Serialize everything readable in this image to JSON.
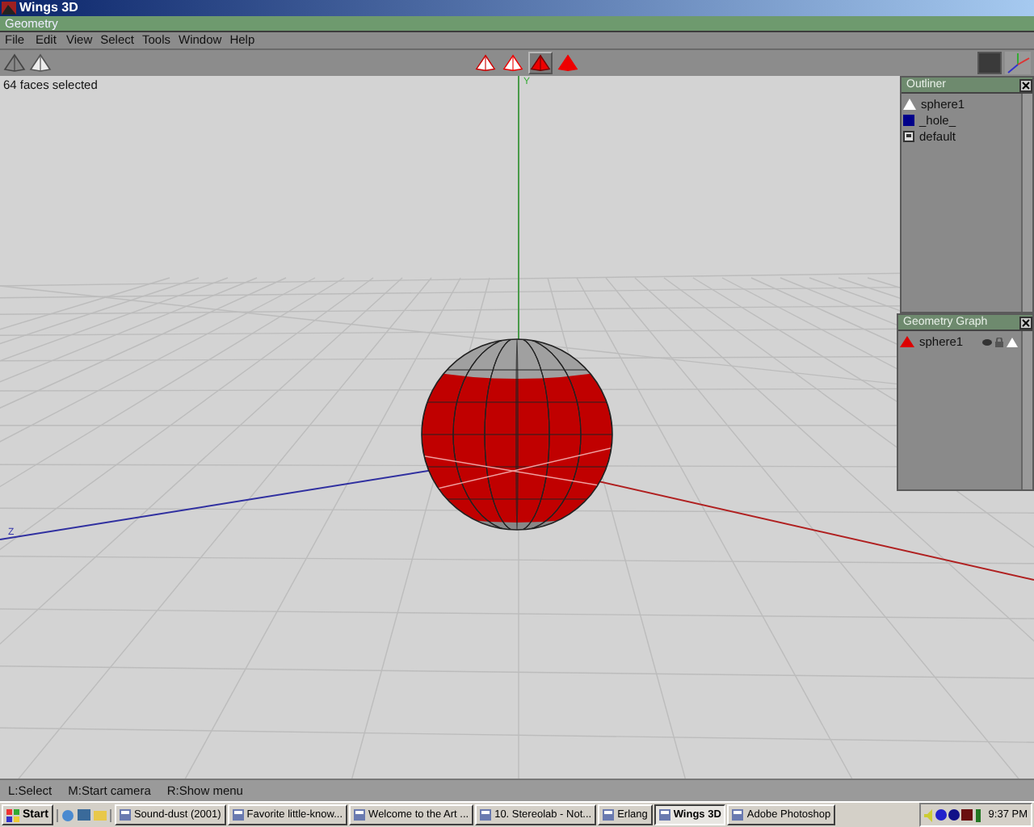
{
  "window": {
    "title": "Wings 3D"
  },
  "geometry_window": {
    "title": "Geometry"
  },
  "menu": [
    "File",
    "Edit",
    "View",
    "Select",
    "Tools",
    "Window",
    "Help"
  ],
  "toolbar": {
    "selection_modes": [
      {
        "kind": "vertex",
        "selected": false
      },
      {
        "kind": "edge",
        "selected": false
      },
      {
        "kind": "face",
        "selected": true
      },
      {
        "kind": "body",
        "selected": false
      }
    ]
  },
  "viewport": {
    "info": "64 faces selected",
    "axis_labels": [
      {
        "kind": "y",
        "label": "Y"
      },
      {
        "kind": "z",
        "label": "Z"
      }
    ]
  },
  "outliner": {
    "title": "Outliner",
    "items": [
      {
        "kind": "object",
        "label": "sphere1"
      },
      {
        "kind": "hole",
        "label": "_hole_"
      },
      {
        "kind": "material",
        "label": "default"
      }
    ]
  },
  "geometry_graph": {
    "title": "Geometry Graph",
    "items": [
      {
        "label": "sphere1"
      }
    ]
  },
  "status_bar": [
    "L:Select",
    "M:Start camera",
    "R:Show menu"
  ],
  "taskbar": {
    "start": "Start",
    "tasks": [
      {
        "label": "Sound-dust (2001)",
        "selected": false
      },
      {
        "label": "Favorite little-know...",
        "selected": false
      },
      {
        "label": "Welcome to the Art ...",
        "selected": false
      },
      {
        "label": "10. Stereolab - Not...",
        "selected": false
      },
      {
        "label": "Erlang",
        "selected": false
      },
      {
        "label": "Wings 3D",
        "selected": true
      },
      {
        "label": "Adobe Photoshop",
        "selected": false
      }
    ],
    "clock": "9:37 PM"
  }
}
